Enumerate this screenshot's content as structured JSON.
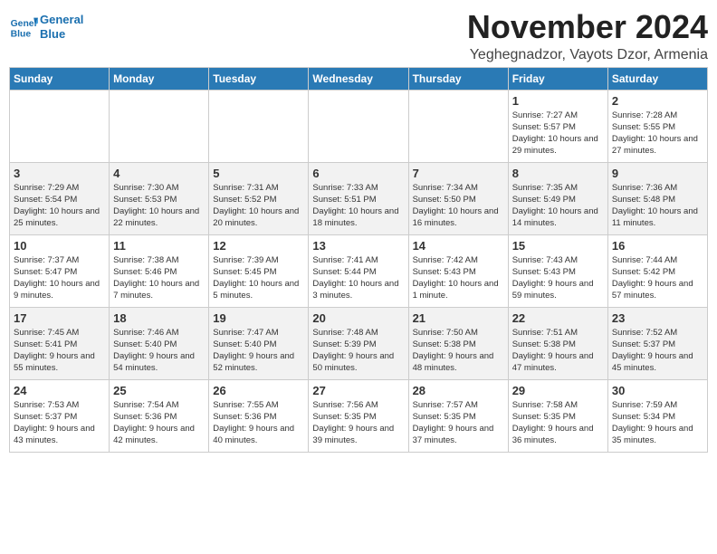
{
  "logo": {
    "line1": "General",
    "line2": "Blue"
  },
  "title": "November 2024",
  "location": "Yeghegnadzor, Vayots Dzor, Armenia",
  "weekdays": [
    "Sunday",
    "Monday",
    "Tuesday",
    "Wednesday",
    "Thursday",
    "Friday",
    "Saturday"
  ],
  "weeks": [
    [
      {
        "day": "",
        "info": ""
      },
      {
        "day": "",
        "info": ""
      },
      {
        "day": "",
        "info": ""
      },
      {
        "day": "",
        "info": ""
      },
      {
        "day": "",
        "info": ""
      },
      {
        "day": "1",
        "info": "Sunrise: 7:27 AM\nSunset: 5:57 PM\nDaylight: 10 hours and 29 minutes."
      },
      {
        "day": "2",
        "info": "Sunrise: 7:28 AM\nSunset: 5:55 PM\nDaylight: 10 hours and 27 minutes."
      }
    ],
    [
      {
        "day": "3",
        "info": "Sunrise: 7:29 AM\nSunset: 5:54 PM\nDaylight: 10 hours and 25 minutes."
      },
      {
        "day": "4",
        "info": "Sunrise: 7:30 AM\nSunset: 5:53 PM\nDaylight: 10 hours and 22 minutes."
      },
      {
        "day": "5",
        "info": "Sunrise: 7:31 AM\nSunset: 5:52 PM\nDaylight: 10 hours and 20 minutes."
      },
      {
        "day": "6",
        "info": "Sunrise: 7:33 AM\nSunset: 5:51 PM\nDaylight: 10 hours and 18 minutes."
      },
      {
        "day": "7",
        "info": "Sunrise: 7:34 AM\nSunset: 5:50 PM\nDaylight: 10 hours and 16 minutes."
      },
      {
        "day": "8",
        "info": "Sunrise: 7:35 AM\nSunset: 5:49 PM\nDaylight: 10 hours and 14 minutes."
      },
      {
        "day": "9",
        "info": "Sunrise: 7:36 AM\nSunset: 5:48 PM\nDaylight: 10 hours and 11 minutes."
      }
    ],
    [
      {
        "day": "10",
        "info": "Sunrise: 7:37 AM\nSunset: 5:47 PM\nDaylight: 10 hours and 9 minutes."
      },
      {
        "day": "11",
        "info": "Sunrise: 7:38 AM\nSunset: 5:46 PM\nDaylight: 10 hours and 7 minutes."
      },
      {
        "day": "12",
        "info": "Sunrise: 7:39 AM\nSunset: 5:45 PM\nDaylight: 10 hours and 5 minutes."
      },
      {
        "day": "13",
        "info": "Sunrise: 7:41 AM\nSunset: 5:44 PM\nDaylight: 10 hours and 3 minutes."
      },
      {
        "day": "14",
        "info": "Sunrise: 7:42 AM\nSunset: 5:43 PM\nDaylight: 10 hours and 1 minute."
      },
      {
        "day": "15",
        "info": "Sunrise: 7:43 AM\nSunset: 5:43 PM\nDaylight: 9 hours and 59 minutes."
      },
      {
        "day": "16",
        "info": "Sunrise: 7:44 AM\nSunset: 5:42 PM\nDaylight: 9 hours and 57 minutes."
      }
    ],
    [
      {
        "day": "17",
        "info": "Sunrise: 7:45 AM\nSunset: 5:41 PM\nDaylight: 9 hours and 55 minutes."
      },
      {
        "day": "18",
        "info": "Sunrise: 7:46 AM\nSunset: 5:40 PM\nDaylight: 9 hours and 54 minutes."
      },
      {
        "day": "19",
        "info": "Sunrise: 7:47 AM\nSunset: 5:40 PM\nDaylight: 9 hours and 52 minutes."
      },
      {
        "day": "20",
        "info": "Sunrise: 7:48 AM\nSunset: 5:39 PM\nDaylight: 9 hours and 50 minutes."
      },
      {
        "day": "21",
        "info": "Sunrise: 7:50 AM\nSunset: 5:38 PM\nDaylight: 9 hours and 48 minutes."
      },
      {
        "day": "22",
        "info": "Sunrise: 7:51 AM\nSunset: 5:38 PM\nDaylight: 9 hours and 47 minutes."
      },
      {
        "day": "23",
        "info": "Sunrise: 7:52 AM\nSunset: 5:37 PM\nDaylight: 9 hours and 45 minutes."
      }
    ],
    [
      {
        "day": "24",
        "info": "Sunrise: 7:53 AM\nSunset: 5:37 PM\nDaylight: 9 hours and 43 minutes."
      },
      {
        "day": "25",
        "info": "Sunrise: 7:54 AM\nSunset: 5:36 PM\nDaylight: 9 hours and 42 minutes."
      },
      {
        "day": "26",
        "info": "Sunrise: 7:55 AM\nSunset: 5:36 PM\nDaylight: 9 hours and 40 minutes."
      },
      {
        "day": "27",
        "info": "Sunrise: 7:56 AM\nSunset: 5:35 PM\nDaylight: 9 hours and 39 minutes."
      },
      {
        "day": "28",
        "info": "Sunrise: 7:57 AM\nSunset: 5:35 PM\nDaylight: 9 hours and 37 minutes."
      },
      {
        "day": "29",
        "info": "Sunrise: 7:58 AM\nSunset: 5:35 PM\nDaylight: 9 hours and 36 minutes."
      },
      {
        "day": "30",
        "info": "Sunrise: 7:59 AM\nSunset: 5:34 PM\nDaylight: 9 hours and 35 minutes."
      }
    ]
  ]
}
